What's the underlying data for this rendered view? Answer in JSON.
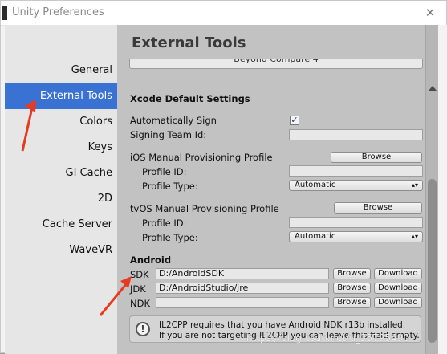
{
  "window": {
    "title": "Unity Preferences",
    "close_glyph": "✕"
  },
  "sidebar": {
    "items": [
      {
        "label": "General",
        "active": false
      },
      {
        "label": "External Tools",
        "active": true
      },
      {
        "label": "Colors",
        "active": false
      },
      {
        "label": "Keys",
        "active": false
      },
      {
        "label": "GI Cache",
        "active": false
      },
      {
        "label": "2D",
        "active": false
      },
      {
        "label": "Cache Server",
        "active": false
      },
      {
        "label": "WaveVR",
        "active": false
      }
    ]
  },
  "content": {
    "title": "External Tools",
    "diff_tool_value": "Beyond Compare 4",
    "xcode": {
      "section_title": "Xcode Default Settings",
      "auto_sign_label": "Automatically Sign",
      "auto_sign_checked": true,
      "auto_sign_mark": "✓",
      "team_id_label": "Signing Team Id:",
      "team_id_value": ""
    },
    "ios": {
      "section_title": "iOS Manual Provisioning Profile",
      "browse_label": "Browse",
      "profile_id_label": "Profile ID:",
      "profile_id_value": "",
      "profile_type_label": "Profile Type:",
      "profile_type_value": "Automatic"
    },
    "tvos": {
      "section_title": "tvOS Manual Provisioning Profile",
      "browse_label": "Browse",
      "profile_id_label": "Profile ID:",
      "profile_id_value": "",
      "profile_type_label": "Profile Type:",
      "profile_type_value": "Automatic"
    },
    "android": {
      "section_title": "Android",
      "rows": [
        {
          "label": "SDK",
          "value": "D:/AndroidSDK",
          "browse_label": "Browse",
          "download_label": "Download"
        },
        {
          "label": "JDK",
          "value": "D:/AndroidStudio/jre",
          "browse_label": "Browse",
          "download_label": "Download"
        },
        {
          "label": "NDK",
          "value": "",
          "browse_label": "Browse",
          "download_label": "Download"
        }
      ],
      "help_line1": "IL2CPP requires that you have Android NDK r13b installed.",
      "help_line2": "If you are not targeting IL2CPP you can leave this field empty."
    }
  },
  "watermark": "https://blog.csdn.net/u_35795490",
  "colors": {
    "accent": "#3a72d4",
    "annotation_arrow": "#e83a20"
  },
  "icons": {
    "info": "info-icon",
    "dropdown_arrow": "▴▾"
  }
}
